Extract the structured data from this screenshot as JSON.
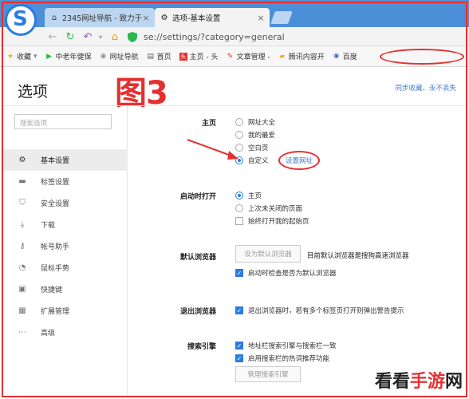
{
  "tabs": [
    {
      "label": "2345网址导航 - 致力于",
      "icon": "home-icon"
    },
    {
      "label": "选项-基本设置",
      "icon": "gear-icon"
    }
  ],
  "address": {
    "url": "se://settings/?category=general"
  },
  "bookmarks": [
    {
      "label": "收藏",
      "icon": "star-icon"
    },
    {
      "label": "中老年健保",
      "icon": "play-icon"
    },
    {
      "label": "网址导航",
      "icon": "globe-icon"
    },
    {
      "label": "首页",
      "icon": "page-icon"
    },
    {
      "label": "主页 - 头",
      "icon": "toutiao-icon"
    },
    {
      "label": "文章管理 -",
      "icon": "article-icon"
    },
    {
      "label": "腾讯内容开",
      "icon": "folder-icon"
    },
    {
      "label": "百度",
      "icon": "baidu-icon"
    }
  ],
  "page": {
    "title": "选项",
    "annotation": "图3",
    "sync_link": "同步收藏、永不丢失",
    "search_placeholder": "搜索选项"
  },
  "sidebar": {
    "items": [
      {
        "label": "基本设置",
        "icon": "gear-icon"
      },
      {
        "label": "标签设置",
        "icon": "tab-icon"
      },
      {
        "label": "安全设置",
        "icon": "shield-icon"
      },
      {
        "label": "下载",
        "icon": "download-icon"
      },
      {
        "label": "帐号助手",
        "icon": "key-icon"
      },
      {
        "label": "鼠标手势",
        "icon": "mouse-icon"
      },
      {
        "label": "快捷键",
        "icon": "keyboard-icon"
      },
      {
        "label": "扩展管理",
        "icon": "extension-icon"
      },
      {
        "label": "高级",
        "icon": "more-icon"
      }
    ],
    "selected_index": 0
  },
  "homepage": {
    "label": "主页",
    "options": [
      "网址大全",
      "我的最爱",
      "空白页",
      "自定义"
    ],
    "selected_index": 3,
    "set_url_link": "设置网址"
  },
  "startup": {
    "label": "启动时打开",
    "options": [
      "主页",
      "上次未关闭的页面"
    ],
    "selected_index": 0,
    "check_label": "始终打开我的起始页",
    "check_on": false
  },
  "default_browser": {
    "label": "默认浏览器",
    "button": "设为默认浏览器",
    "status": "目前默认浏览器是搜狗高速浏览器",
    "check_label": "启动时检查是否为默认浏览器",
    "check_on": true
  },
  "exit_browser": {
    "label": "退出浏览器",
    "check_label": "退出浏览器时，若有多个标签页打开则弹出警告提示",
    "check_on": true
  },
  "search_engine": {
    "label": "搜索引擎",
    "checks": [
      "地址栏搜索引擎与搜索栏一致",
      "启用搜索栏的热词推荐功能"
    ],
    "button": "管理搜索引擎"
  },
  "watermark": {
    "a": "看看",
    "b": "手游",
    "c": "网"
  },
  "colors": {
    "accent": "#2a7de0",
    "annotation_red": "#e53030",
    "tabbar": "#4a8fd8"
  }
}
